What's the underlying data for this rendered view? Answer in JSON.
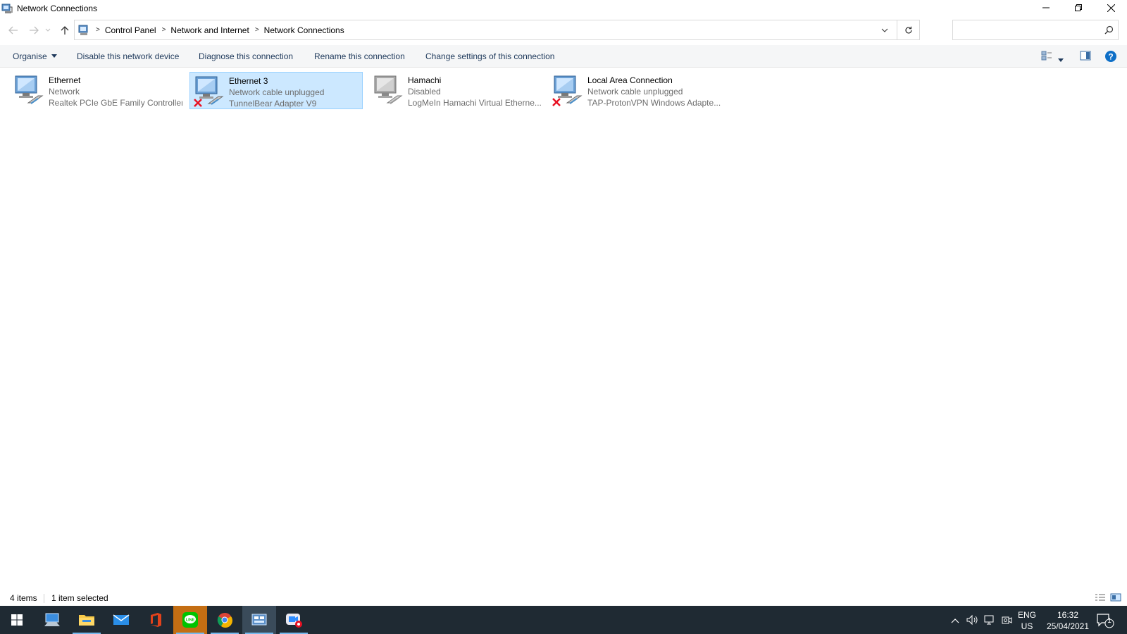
{
  "window": {
    "title": "Network Connections"
  },
  "address": {
    "crumbs": [
      "Control Panel",
      "Network and Internet",
      "Network Connections"
    ],
    "search_placeholder": ""
  },
  "commandbar": {
    "organise": "Organise",
    "disable": "Disable this network device",
    "diagnose": "Diagnose this connection",
    "rename": "Rename this connection",
    "change": "Change settings of this connection"
  },
  "connections": [
    {
      "name": "Ethernet",
      "status": "Network",
      "adapter": "Realtek PCIe GbE Family Controller",
      "state": "connected",
      "selected": false
    },
    {
      "name": "Ethernet 3",
      "status": "Network cable unplugged",
      "adapter": "TunnelBear Adapter V9",
      "state": "unplugged",
      "selected": true
    },
    {
      "name": "Hamachi",
      "status": "Disabled",
      "adapter": "LogMeIn Hamachi Virtual Etherne...",
      "state": "disabled",
      "selected": false
    },
    {
      "name": "Local Area Connection",
      "status": "Network cable unplugged",
      "adapter": "TAP-ProtonVPN Windows Adapte...",
      "state": "unplugged",
      "selected": false
    }
  ],
  "statusbar": {
    "count": "4 items",
    "selection": "1 item selected"
  },
  "taskbar": {
    "apps": [
      "start-icon",
      "remote-desktop-icon",
      "file-explorer-icon",
      "mail-icon",
      "office-icon",
      "line-icon",
      "chrome-icon",
      "control-panel-icon",
      "zoom-icon"
    ],
    "language_top": "ENG",
    "language_bottom": "US",
    "time": "16:32",
    "date": "25/04/2021",
    "notifications": "1"
  },
  "colors": {
    "accent": "#0078d7",
    "selection": "#cce8ff",
    "taskbar": "#1f2a33",
    "error": "#e81123"
  }
}
